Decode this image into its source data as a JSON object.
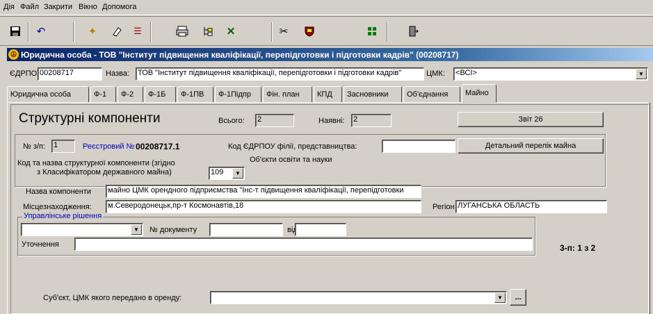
{
  "menu": {
    "items": [
      "Дія",
      "Файл",
      "Закрити",
      "Вікно",
      "Допомога"
    ]
  },
  "window": {
    "title": "Юридична особа - ТОВ \"Інститут підвищення кваліфікації, перепідготовки і підготовки кадрів\" (00208717)"
  },
  "header": {
    "edrpou_label": "ЄДРПОУ:",
    "edrpou_value": "00208717",
    "name_label": "Назва:",
    "name_value": "ТОВ \"Інститут підвищення кваліфікації, перепідготовки і підготовки кадрів\"",
    "cmk_label": "ЦМК:",
    "cmk_value": "<ВСІ>"
  },
  "tabs": [
    {
      "label": "Юридична особа"
    },
    {
      "label": "Ф-1"
    },
    {
      "label": "Ф-2"
    },
    {
      "label": "Ф-1Б"
    },
    {
      "label": "Ф-1ПВ"
    },
    {
      "label": "Ф-1Підпр"
    },
    {
      "label": "Фін. план"
    },
    {
      "label": "КПД"
    },
    {
      "label": "Засновники"
    },
    {
      "label": "Об'єднання"
    },
    {
      "label": "Майно"
    }
  ],
  "main": {
    "heading": "Структурні компоненти",
    "total_label": "Всього:",
    "total_value": "2",
    "present_label": "Наявні:",
    "present_value": "2",
    "report_button": "Звіт 26",
    "seq_label": "№ з/п:",
    "seq_value": "1",
    "reg_label": "Реєстровий №",
    "reg_value": "00208717.1",
    "branch_code_label": "Код ЄДРПОУ філії, представництва:",
    "branch_code_value": "",
    "detail_button": "Детальний перелік майна",
    "component_code_label_1": "Код та назва структурної компоненти (згідно",
    "component_code_label_2": "з Класифікатором державного майна)",
    "component_code_value": "109",
    "component_code_desc": "Об'єкти освіти та науки",
    "component_name_label": "Назва компоненти",
    "component_name_value": "майно ЦМК орендного  підприємства \"Інс-т підвищення кваліфікації, перепідготовки",
    "location_label": "Місцезнаходження:",
    "location_value": "м.Северодонецьк,пр-т Космонавтів,18",
    "region_label": "Регіон",
    "region_value": "ЛУГАНСЬКА ОБЛАСТЬ",
    "decisions_title": "Управлінське рішення",
    "decision_value": "",
    "doc_no_label": "№ документу",
    "doc_no_value": "",
    "date_label": "від",
    "date_value": "",
    "clarif_label": "Уточнення",
    "clarif_value": "",
    "record_counter": "3-п: 1 з 2",
    "lessee_label": "Суб'єкт, ЦМК якого передано в оренду:",
    "lessee_value": "",
    "ellipsis": "..."
  },
  "toolbar": {
    "icons": [
      "save-icon",
      "undo-icon",
      "new-icon",
      "eraser-icon",
      "filter-icon",
      "print-icon",
      "tree-icon",
      "excel-icon",
      "cut-icon",
      "shield-icon",
      "grid-icon",
      "exit-icon"
    ]
  }
}
